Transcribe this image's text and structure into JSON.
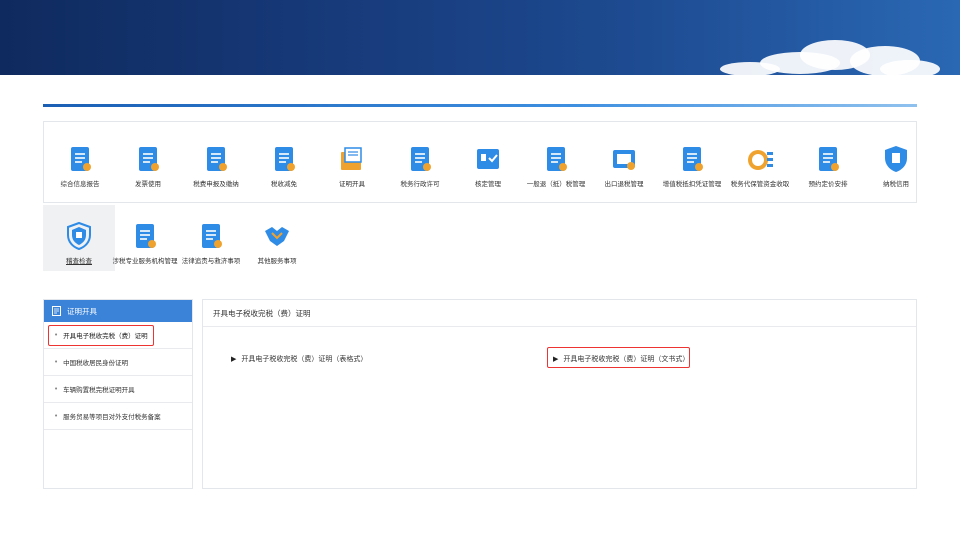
{
  "top_nav": [
    {
      "label": "综合信息报告",
      "icon": "report-icon",
      "color": "#2e8be6"
    },
    {
      "label": "发票使用",
      "icon": "invoice-icon",
      "color": "#2e8be6"
    },
    {
      "label": "税费申报及缴纳",
      "icon": "tax-payment-icon",
      "color": "#2e8be6"
    },
    {
      "label": "税收减免",
      "icon": "tax-reduction-icon",
      "color": "#2e8be6"
    },
    {
      "label": "证明开具",
      "icon": "certificate-icon",
      "color": "#f0a22e"
    },
    {
      "label": "税务行政许可",
      "icon": "license-icon",
      "color": "#2e8be6"
    },
    {
      "label": "核定管理",
      "icon": "assessment-icon",
      "color": "#2e8be6"
    },
    {
      "label": "一般退（抵）税管理",
      "icon": "refund-icon",
      "color": "#2e8be6"
    },
    {
      "label": "出口退税管理",
      "icon": "export-refund-icon",
      "color": "#2e8be6"
    },
    {
      "label": "增值税抵扣凭证管理",
      "icon": "vat-deduction-icon",
      "color": "#2e8be6"
    },
    {
      "label": "税务代保管资金收取",
      "icon": "custody-funds-icon",
      "color": "#f0a22e"
    },
    {
      "label": "预约定价安排",
      "icon": "pricing-icon",
      "color": "#2e8be6"
    },
    {
      "label": "纳税信用",
      "icon": "credit-icon",
      "color": "#2e8be6"
    }
  ],
  "second_nav": [
    {
      "label": "稽查检查",
      "icon": "inspection-shield-icon",
      "color": "#2e8be6"
    },
    {
      "label": "涉税专业服务机构管理",
      "icon": "agency-icon",
      "color": "#2e8be6"
    },
    {
      "label": "法律追责与救济事项",
      "icon": "legal-icon",
      "color": "#2e8be6"
    },
    {
      "label": "其他服务事项",
      "icon": "handshake-icon",
      "color": "#2e8be6"
    }
  ],
  "sidebar": {
    "title": "证明开具",
    "items": [
      {
        "label": "开具电子税收完税（费）证明"
      },
      {
        "label": "中国税收居民身份证明"
      },
      {
        "label": "车辆购置税完税证明开具"
      },
      {
        "label": "服务贸易等项目对外支付税务备案"
      }
    ]
  },
  "main": {
    "title": "开具电子税收完税（费）证明",
    "link_table": "开具电子税收完税（费）证明（表格式）",
    "link_document": "开具电子税收完税（费）证明（文书式）"
  },
  "colors": {
    "accent": "#3a83d9",
    "highlight": "#e33333"
  }
}
